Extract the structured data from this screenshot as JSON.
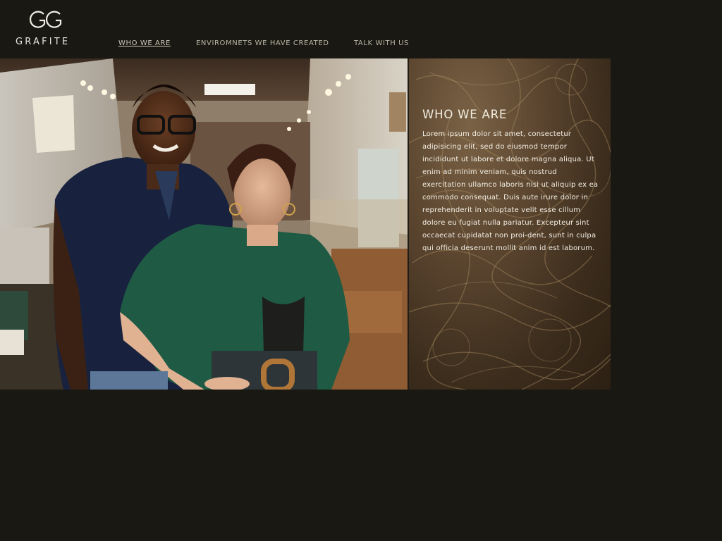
{
  "brand": {
    "name": "GRAFITE",
    "mark": "GG"
  },
  "nav": {
    "items": [
      {
        "label": "WHO WE ARE",
        "active": true
      },
      {
        "label": "ENVIROMNETS WE HAVE CREATED",
        "active": false
      },
      {
        "label": "TALK WITH US",
        "active": false
      }
    ]
  },
  "section": {
    "title": "WHO WE ARE",
    "body": "Lorem ipsum dolor sit amet, consectetur adipisicing elit, sed do eiusmod tempor incididunt ut labore et dolore magna aliqua. Ut enim ad minim veniam, quis nostrud exercitation ullamco laboris nisi ut aliquip ex ea commodo consequat. Duis aute irure dolor in reprehenderit in voluptate velit esse cillum dolore eu fugiat nulla pariatur. Excepteur sint occaecat cupidatat non proi-dent, sunt in culpa qui officia deserunt mollit anim id est laborum."
  },
  "colors": {
    "background": "#191812",
    "nav_text": "#b8b4a6",
    "panel_text": "#f4f0e6"
  },
  "icons": {
    "logo": "gg-monogram-icon"
  }
}
